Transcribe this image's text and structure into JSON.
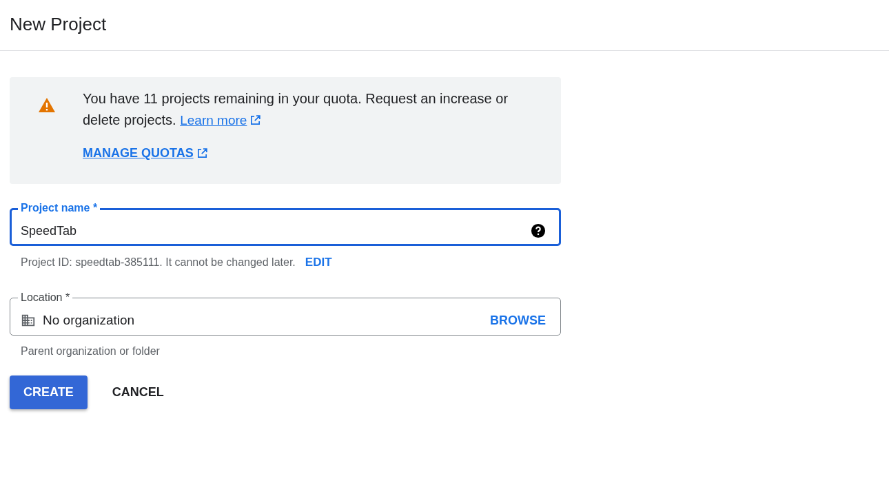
{
  "header": {
    "title": "New Project"
  },
  "notice": {
    "text": "You have 11 projects remaining in your quota. Request an increase or delete projects.",
    "link": "Learn more",
    "action": "MANAGE QUOTAS"
  },
  "fields": [
    {
      "kind": "text",
      "label": "Project name *",
      "value": "SpeedTab",
      "focused": true,
      "helper": "Project ID: speedtab-385111. It cannot be changed later.",
      "helper_action": "EDIT"
    },
    {
      "kind": "location",
      "label": "Location *",
      "value": "No organization",
      "focused": false,
      "action": "BROWSE",
      "helper": "Parent organization or folder"
    }
  ],
  "buttons": [
    {
      "label": "CREATE",
      "kind": "primary"
    },
    {
      "label": "CANCEL",
      "kind": "text"
    }
  ]
}
